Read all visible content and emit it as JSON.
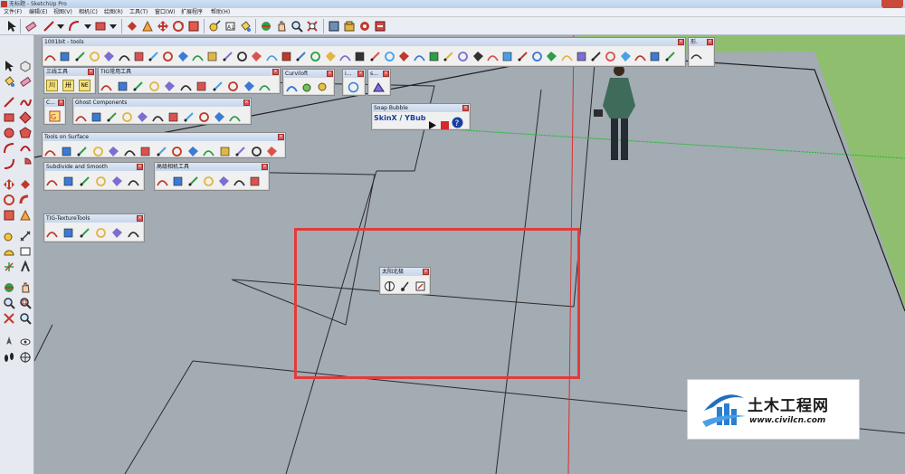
{
  "window": {
    "title": "无标题 - SketchUp Pro"
  },
  "menu": [
    "文件(F)",
    "编辑(E)",
    "视图(V)",
    "相机(C)",
    "绘图(R)",
    "工具(T)",
    "窗口(W)",
    "扩展程序",
    "帮助(H)"
  ],
  "toolbars": {
    "tools1001": {
      "title": "1001bit - tools"
    },
    "right_partial": {
      "title": "形."
    },
    "sanxian": {
      "title": "三线工具",
      "buttons": [
        "川",
        "卅",
        "NE"
      ]
    },
    "tig_common": {
      "title": "TIG常用工具"
    },
    "curviloft": {
      "title": "Curviloft"
    },
    "small1": {
      "title": "i..."
    },
    "small2": {
      "title": "s..."
    },
    "c_toolbar": {
      "title": "C..."
    },
    "ghost": {
      "title": "Ghost Components"
    },
    "soap": {
      "title": "Soap Bubble",
      "label": "SkinX / YBub"
    },
    "tools_on_surface": {
      "title": "Tools on Surface"
    },
    "subdivide": {
      "title": "Subdivide and Smooth"
    },
    "camera_tools": {
      "title": "高级相机工具"
    },
    "texture": {
      "title": "TIG-TextureTools"
    },
    "sun_north": {
      "title": "太阳北极"
    }
  },
  "watermark": {
    "name": "土木工程网",
    "url": "www.civilcn.com"
  },
  "colors": {
    "viewport_bg": "#a3abb3",
    "ground": "#8fbf6e",
    "highlight_box": "#e23b3b",
    "axis_green": "#1bbd2b",
    "axis_red": "#d93030"
  }
}
